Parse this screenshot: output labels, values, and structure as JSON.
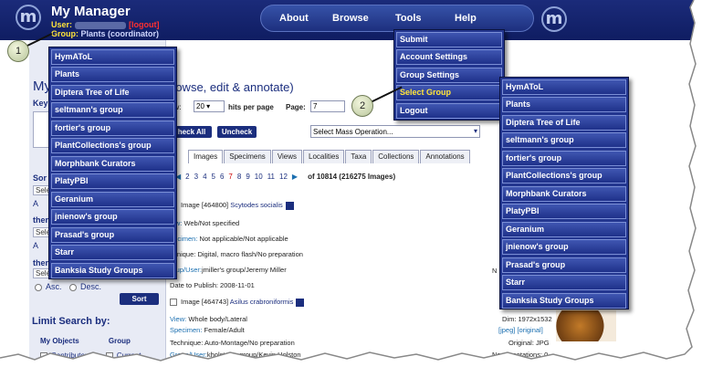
{
  "header": {
    "app_title": "My Manager",
    "user_key": "User:",
    "logout_label": "[logout]",
    "group_key": "Group:",
    "group_value": "Plants (coordinator)",
    "logo_glyph": "m"
  },
  "nav": {
    "about": "About",
    "browse": "Browse",
    "tools": "Tools",
    "help": "Help"
  },
  "tools_menu": [
    {
      "label": "Submit"
    },
    {
      "label": "Account Settings"
    },
    {
      "label": "Group Settings"
    },
    {
      "label": "Select Group"
    },
    {
      "label": "Logout"
    }
  ],
  "group_menu_left": [
    "HymAToL",
    "Plants",
    "Diptera Tree of Life",
    "seltmann's group",
    "fortier's group",
    "PlantCollections's group",
    "Morphbank Curators",
    "PlatyPBI",
    "Geranium",
    "jnienow's group",
    "Prasad's group",
    "Starr",
    "Banksia Study Groups"
  ],
  "group_menu_right": [
    "HymAToL",
    "Plants",
    "Diptera Tree of Life",
    "seltmann's group",
    "fortier's group",
    "PlantCollections's group",
    "Morphbank Curators",
    "PlatyPBI",
    "Geranium",
    "jnienow's group",
    "Prasad's group",
    "Starr",
    "Banksia Study Groups"
  ],
  "callouts": {
    "one": "1",
    "two": "2"
  },
  "left": {
    "title_partial": "My",
    "keyword_partial": "Key",
    "sort_partial": "Sor",
    "select_partial": "Sele",
    "then1": "then",
    "then2": "then",
    "asc": "Asc.",
    "desc": "Desc.",
    "a_partial": "A",
    "sort_button": "Sort",
    "limit_title": "Limit Search by:",
    "my_objects": "My Objects",
    "group": "Group",
    "contributor": "Contributor",
    "current": "Current"
  },
  "main": {
    "title": "rowse, edit & annotate)",
    "show_partial": "ow:",
    "show_value": "20",
    "hits_label": "hits per page",
    "page_label": "Page:",
    "page_value": "7",
    "check_all": "heck All",
    "uncheck": "Uncheck",
    "mass_select": "Select Mass Operation...",
    "tabs": [
      "Images",
      "Specimens",
      "Views",
      "Localities",
      "Taxa",
      "Collections",
      "Annotations"
    ],
    "pages": [
      "2",
      "3",
      "4",
      "5",
      "6",
      "7",
      "8",
      "9",
      "10",
      "11",
      "12"
    ],
    "current_page": "7",
    "summary": "of 10814 (216275 Images)"
  },
  "records": [
    {
      "image": "Image [464800]",
      "taxon": "Scytodes socialis",
      "view_key": "iew:",
      "view": "Web/Not specified",
      "spec_key": "pecimen:",
      "spec": "Not applicable/Not applicable",
      "tech": "chnique: Digital, macro flash/No preparation",
      "group_key": "roup/User:",
      "group": "jmiller's group/Jeremy Miller",
      "date": "Date to Publish: 2008-11-01",
      "right": "N"
    },
    {
      "image": "Image [464743]",
      "taxon": "Asilus crabroniformis",
      "view_key": "View:",
      "view": "Whole body/Lateral",
      "spec_key": "Specimen:",
      "spec": "Female/Adult",
      "tech": "Technique: Auto-Montage/No preparation",
      "group_key": "Group/User:",
      "group": "kholston's group/Kevin Holston",
      "dim": "Dim: 1972x1532",
      "jpeg": "[jpeg]",
      "original": "[original]",
      "orig_fmt": "Original: JPG",
      "annotations": "No. Annotations: 0"
    }
  ]
}
